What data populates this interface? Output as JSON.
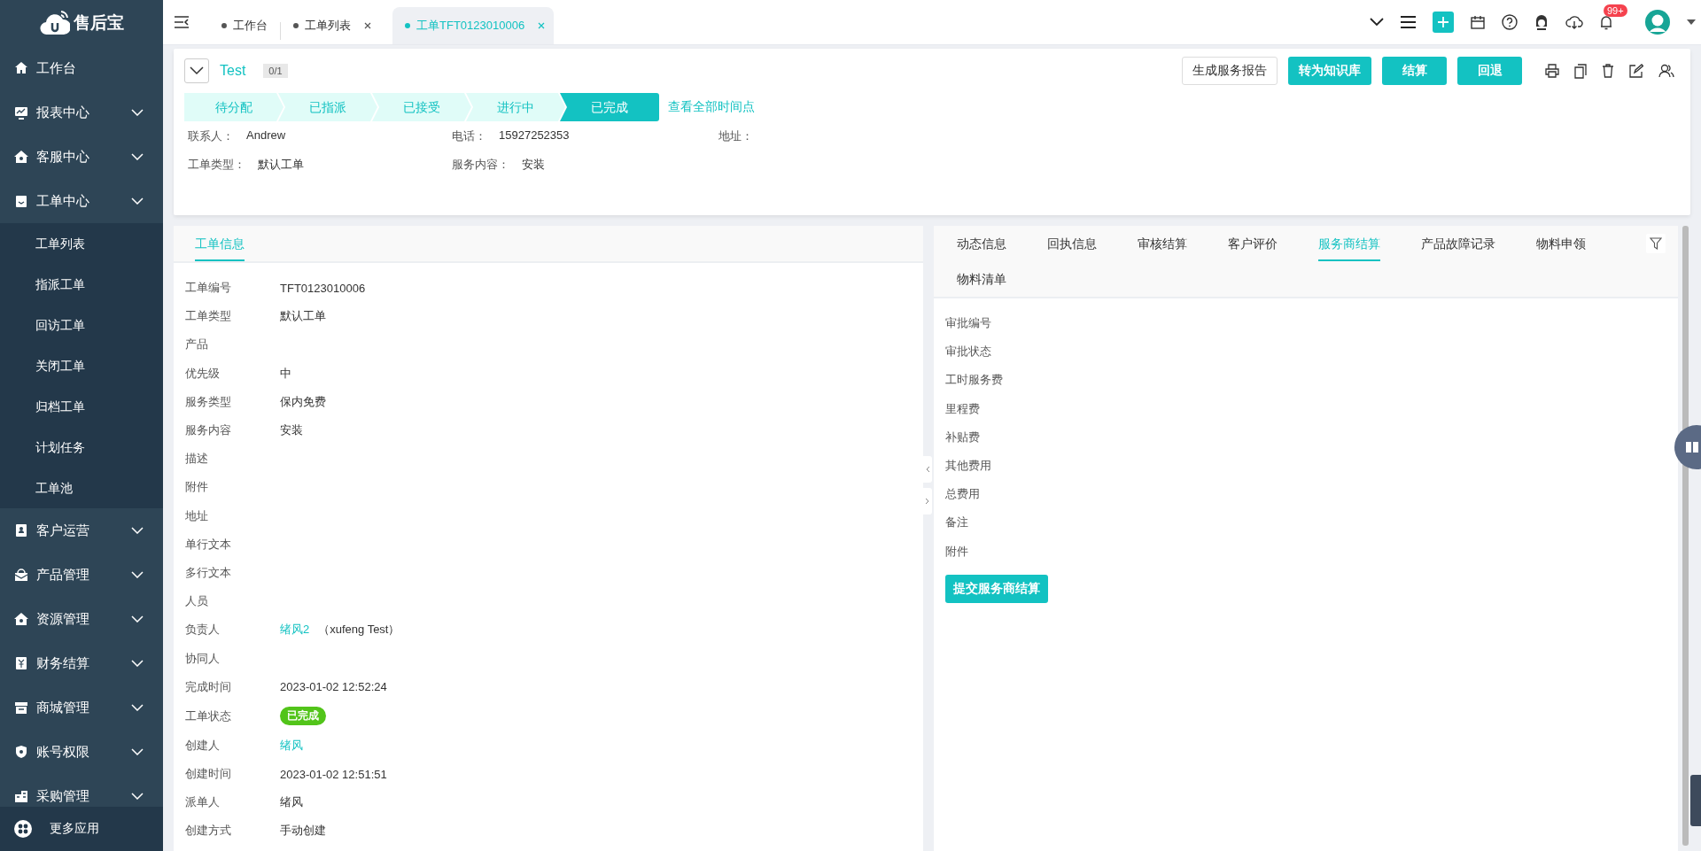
{
  "sidebar": {
    "logo": "售后宝",
    "items": [
      {
        "label": "工作台",
        "kind": "link"
      },
      {
        "label": "报表中心",
        "kind": "group"
      },
      {
        "label": "客服中心",
        "kind": "group"
      },
      {
        "label": "工单中心",
        "kind": "group",
        "expanded": true,
        "children": [
          {
            "label": "工单列表"
          },
          {
            "label": "指派工单"
          },
          {
            "label": "回访工单"
          },
          {
            "label": "关闭工单"
          },
          {
            "label": "归档工单"
          },
          {
            "label": "计划任务"
          },
          {
            "label": "工单池"
          }
        ]
      },
      {
        "label": "客户运营",
        "kind": "group"
      },
      {
        "label": "产品管理",
        "kind": "group"
      },
      {
        "label": "资源管理",
        "kind": "group"
      },
      {
        "label": "财务结算",
        "kind": "group"
      },
      {
        "label": "商城管理",
        "kind": "group"
      },
      {
        "label": "账号权限",
        "kind": "group"
      },
      {
        "label": "采购管理",
        "kind": "group"
      }
    ],
    "more_apps": "更多应用"
  },
  "top_bar": {
    "tabs": [
      {
        "label": "工作台",
        "selected": false,
        "closable": false
      },
      {
        "label": "工单列表",
        "selected": false,
        "closable": true
      },
      {
        "label": "工单TFT0123010006",
        "selected": true,
        "closable": true
      }
    ],
    "notification_badge": "99+"
  },
  "order": {
    "title": "Test",
    "count": "0/1",
    "buttons": [
      {
        "label": "生成服务报告",
        "kind": "outline"
      },
      {
        "label": "转为知识库",
        "kind": "primary"
      },
      {
        "label": "结算",
        "kind": "primary"
      },
      {
        "label": "回退",
        "kind": "primary"
      }
    ],
    "steps": [
      {
        "label": "待分配",
        "selected": false
      },
      {
        "label": "已指派",
        "selected": false
      },
      {
        "label": "已接受",
        "selected": false
      },
      {
        "label": "进行中",
        "selected": false
      },
      {
        "label": "已完成",
        "selected": true
      }
    ],
    "timeline_link": "查看全部时间点",
    "info": [
      {
        "label": "联系人：",
        "value": "Andrew"
      },
      {
        "label": "电话：",
        "value": "15927252353"
      },
      {
        "label": "地址："
      },
      {
        "label": "工单类型：",
        "value": "默认工单"
      },
      {
        "label": "服务内容：",
        "value": "安装"
      }
    ]
  },
  "detail_panel": {
    "tabs": [
      {
        "label": "工单信息",
        "selected": true
      }
    ],
    "fields": [
      {
        "label": "工单编号",
        "value": "TFT0123010006",
        "kind": "text"
      },
      {
        "label": "工单类型",
        "value": "默认工单",
        "kind": "text"
      },
      {
        "label": "产品",
        "kind": "text"
      },
      {
        "label": "优先级",
        "value": "中",
        "kind": "text"
      },
      {
        "label": "服务类型",
        "value": "保内免费",
        "kind": "text"
      },
      {
        "label": "服务内容",
        "value": "安装",
        "kind": "text"
      },
      {
        "label": "描述",
        "kind": "text"
      },
      {
        "label": "附件",
        "kind": "text"
      },
      {
        "label": "地址",
        "kind": "text"
      },
      {
        "label": "单行文本",
        "kind": "text"
      },
      {
        "label": "多行文本",
        "kind": "text"
      },
      {
        "label": "人员",
        "kind": "text"
      },
      {
        "label": "负责人",
        "value": "绪风2",
        "note": "（xufeng Test）",
        "kind": "link"
      },
      {
        "label": "协同人",
        "kind": "text"
      },
      {
        "label": "完成时间",
        "value": "2023-01-02 12:52:24",
        "kind": "text"
      },
      {
        "label": "工单状态",
        "value": "已完成",
        "kind": "status"
      },
      {
        "label": "创建人",
        "value": "绪风",
        "kind": "link"
      },
      {
        "label": "创建时间",
        "value": "2023-01-02 12:51:51",
        "kind": "text"
      },
      {
        "label": "派单人",
        "value": "绪风",
        "kind": "text"
      },
      {
        "label": "创建方式",
        "value": "手动创建",
        "kind": "text"
      }
    ]
  },
  "settlement_panel": {
    "tabs": [
      {
        "label": "动态信息",
        "selected": false
      },
      {
        "label": "回执信息",
        "selected": false
      },
      {
        "label": "审核结算",
        "selected": false
      },
      {
        "label": "客户评价",
        "selected": false
      },
      {
        "label": "服务商结算",
        "selected": true
      },
      {
        "label": "产品故障记录",
        "selected": false
      },
      {
        "label": "物料申领",
        "selected": false
      },
      {
        "label": "物料清单",
        "selected": false
      }
    ],
    "fields": [
      {
        "label": "审批编号"
      },
      {
        "label": "审批状态"
      },
      {
        "label": "工时服务费"
      },
      {
        "label": "里程费"
      },
      {
        "label": "补贴费"
      },
      {
        "label": "其他费用"
      },
      {
        "label": "总费用"
      },
      {
        "label": "备注"
      },
      {
        "label": "附件"
      }
    ],
    "submit_button": "提交服务商结算"
  }
}
